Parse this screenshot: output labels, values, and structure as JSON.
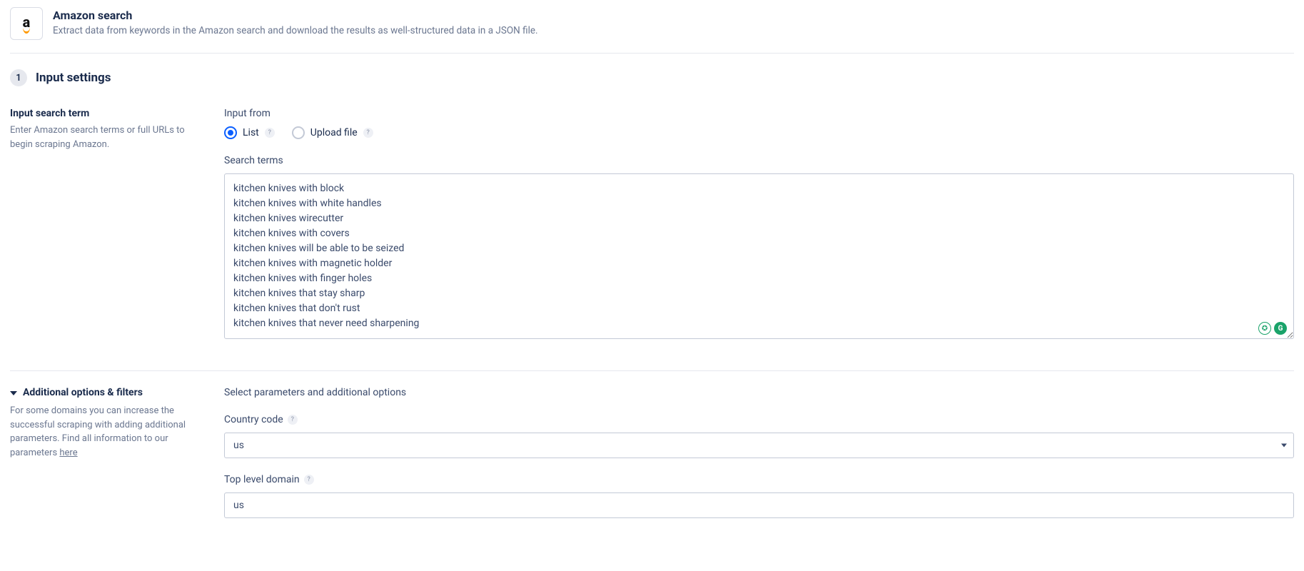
{
  "header": {
    "logo_letter": "a",
    "title": "Amazon search",
    "description": "Extract data from keywords in the Amazon search and download the results as well-structured data in a JSON file."
  },
  "section": {
    "step": "1",
    "title": "Input settings"
  },
  "input_search_term": {
    "title": "Input search term",
    "desc": "Enter Amazon search terms or full URLs to begin scraping Amazon."
  },
  "input_from": {
    "label": "Input from",
    "options": {
      "list": "List",
      "upload": "Upload file"
    },
    "help": "?"
  },
  "search_terms": {
    "label": "Search terms",
    "value": "kitchen knives with block\nkitchen knives with white handles\nkitchen knives wirecutter\nkitchen knives with covers\nkitchen knives will be able to be seized\nkitchen knives with magnetic holder\nkitchen knives with finger holes\nkitchen knives that stay sharp\nkitchen knives that don't rust\nkitchen knives that never need sharpening"
  },
  "additional": {
    "title": "Additional options & filters",
    "desc_pre": "For some domains you can increase the successful scraping with adding additional parameters. Find all information to our parameters ",
    "link": "here",
    "select_label": "Select parameters and additional options"
  },
  "country_code": {
    "label": "Country code",
    "value": "us",
    "help": "?"
  },
  "tld": {
    "label": "Top level domain",
    "value": "us",
    "help": "?"
  },
  "gram": {
    "g1": "✪",
    "g2": "G"
  }
}
